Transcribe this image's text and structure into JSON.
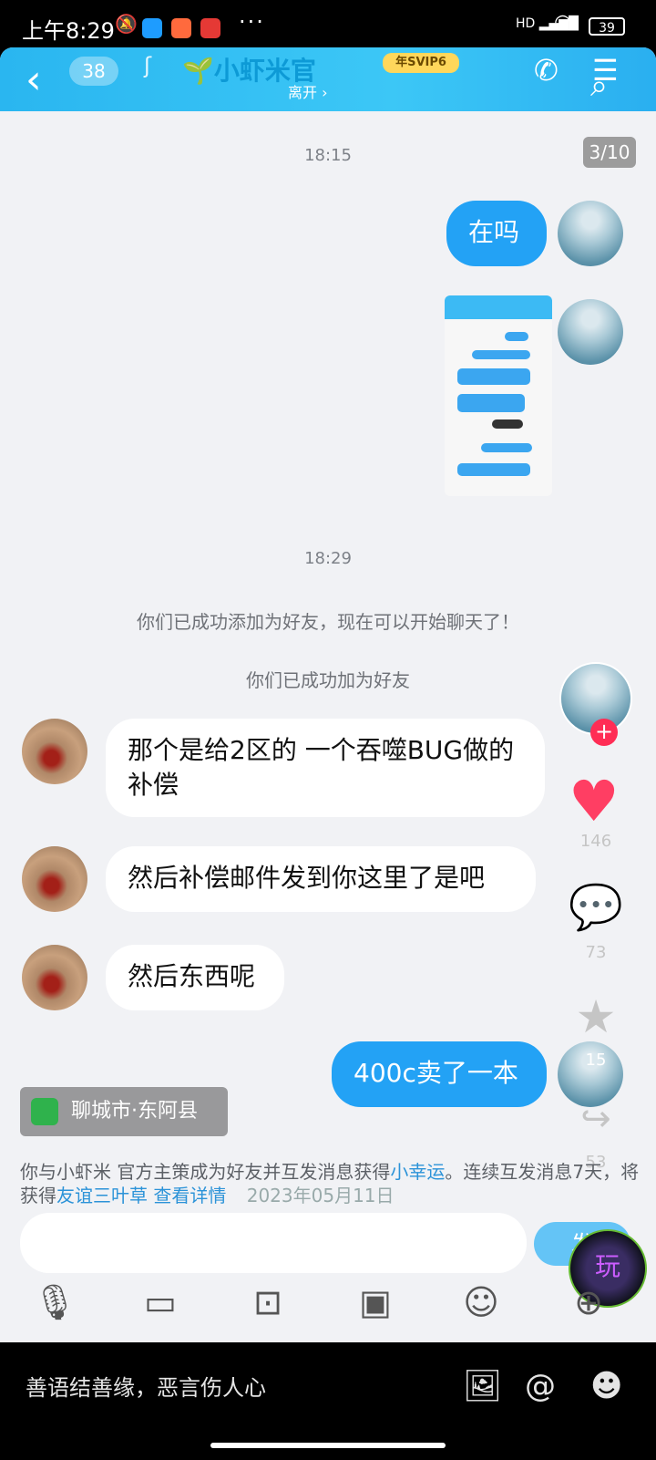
{
  "status_bar": {
    "time": "上午8:29",
    "mute_icon": "bell-off-icon",
    "more": "···",
    "signal": "HD",
    "battery": "39"
  },
  "header": {
    "back_icon": "chevron-left-icon",
    "unread_count": "38",
    "title": "小虾米官",
    "vip_badge": "年SVIP6",
    "presence": "离开 ›",
    "accent": "#2ab6f0"
  },
  "page_indicator": "3/10",
  "messages": {
    "time1": "18:15",
    "out1": "在吗",
    "time2": "18:29",
    "sys1": "你们已成功添加为好友，现在可以开始聊天了！",
    "sys2": "你们已成功加为好友",
    "in1": "那个是给2区的 一个吞噬BUG做的补偿",
    "in2": "然后补偿邮件发到你这里了是吧",
    "in3": "然后东西呢",
    "out2": "400c卖了一本"
  },
  "side_actions": {
    "like_count": "146",
    "comment_count": "73",
    "favorite_count": "15",
    "share_count": "53",
    "follow_icon": "plus-icon"
  },
  "location": "聊城市·东阿县",
  "hint": {
    "part1": "你与小虾米 官方主策成为好友并互发消息获得",
    "link1": "小幸运",
    "part2": "。连续互发消息7天，将获得",
    "link2": "友谊三叶草",
    "link3": "查看详情",
    "overlay_date": "2023年05月11日"
  },
  "input": {
    "send_label": "发"
  },
  "toolbar": {
    "icons": [
      "mic-icon",
      "screen-icon",
      "camera-icon",
      "folder-icon",
      "emoji-icon",
      "plus-icon"
    ]
  },
  "comment_bar": {
    "placeholder": "善语结善缘，恶言伤人心",
    "icons": [
      "image-icon",
      "at-icon",
      "emoji-icon"
    ]
  }
}
